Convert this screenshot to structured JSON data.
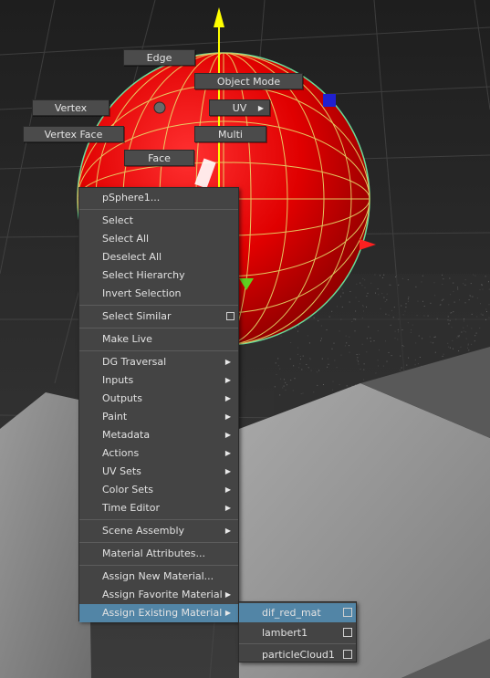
{
  "marking_menu": {
    "edge": "Edge",
    "object_mode": "Object Mode",
    "vertex": "Vertex",
    "uv": "UV",
    "vertex_face": "Vertex Face",
    "multi": "Multi",
    "face": "Face"
  },
  "context_menu": {
    "header": "pSphere1...",
    "items": [
      {
        "label": "Select"
      },
      {
        "label": "Select All"
      },
      {
        "label": "Deselect All"
      },
      {
        "label": "Select Hierarchy"
      },
      {
        "label": "Invert Selection"
      },
      {
        "label": "Select Similar"
      },
      {
        "label": "Make Live"
      },
      {
        "label": "DG Traversal"
      },
      {
        "label": "Inputs"
      },
      {
        "label": "Outputs"
      },
      {
        "label": "Paint"
      },
      {
        "label": "Metadata"
      },
      {
        "label": "Actions"
      },
      {
        "label": "UV Sets"
      },
      {
        "label": "Color Sets"
      },
      {
        "label": "Time Editor"
      },
      {
        "label": "Scene Assembly"
      },
      {
        "label": "Material Attributes..."
      },
      {
        "label": "Assign New Material..."
      },
      {
        "label": "Assign Favorite Material"
      },
      {
        "label": "Assign Existing Material"
      }
    ]
  },
  "submenu": {
    "items": [
      {
        "label": "dif_red_mat"
      },
      {
        "label": "lambert1"
      },
      {
        "label": "particleCloud1"
      }
    ]
  },
  "colors": {
    "sphere": "#e80000",
    "wireframe": "#5fffa0",
    "highlight": "#5285a6",
    "menu_bg": "#444444",
    "menu_text": "#e2e2e2"
  },
  "icons": {
    "submenu_arrow": "triangle-right",
    "option_box": "square-outline"
  }
}
